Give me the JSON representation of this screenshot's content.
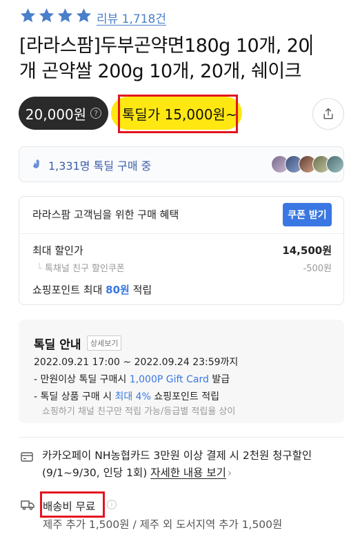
{
  "rating": {
    "stars": 4,
    "review_link": "리뷰 1,718건"
  },
  "product": {
    "title_line1": "[라라스팜]두부곤약면180g 10개, 20",
    "title_line2": "개 곤약쌀 200g 10개, 20개, 쉐이크"
  },
  "pricing": {
    "regular_price": "20,000원",
    "regular_help_icon": "?",
    "deal_price": "톡딜가 15,000원~"
  },
  "buyers": {
    "text": "1,331명 톡딜 구매 중"
  },
  "benefit": {
    "title": "라라스팜 고객님을 위한 구매 혜택",
    "coupon_button": "쿠폰 받기",
    "max_discount_label": "최대 할인가",
    "max_discount_value": "14,500원",
    "friend_coupon_label": "톡채널 친구 할인쿠폰",
    "friend_coupon_value": "-500원",
    "points_pre": "쇼핑포인트 최대",
    "points_value": "80원",
    "points_post": "적립"
  },
  "deal_info": {
    "title": "톡딜 안내",
    "detail_button": "상세보기",
    "period": "2022.09.21 17:00 ~ 2022.09.24 23:59까지",
    "line1_pre": "- 만원이상 톡딜 구매시",
    "line1_blue": "1,000P Gift Card",
    "line1_post": "발급",
    "line2_pre": "- 톡딜 상품 구매 시",
    "line2_blue": "최대 4%",
    "line2_post": "쇼핑포인트 적립",
    "note": "쇼핑하기 채널 친구만 적립 가능/등급별 적립율 상이"
  },
  "card_promo": {
    "text": "카카오페이 NH농협카드 3만원 이상 결제 시 2천원 청구할인",
    "text2": "(9/1~9/30, 인당 1회)",
    "link": "자세한 내용 보기",
    "chevron": "›"
  },
  "shipping": {
    "label": "배송비 무료",
    "info_icon": "i",
    "sub": "제주 추가 1,500원 / 제주 외 도서지역 추가 1,500원"
  },
  "colors": {
    "star": "#4a7fc9",
    "deal_yellow": "#ffe812",
    "highlight_red": "#e3141f",
    "coupon_blue": "#3a77e2"
  }
}
